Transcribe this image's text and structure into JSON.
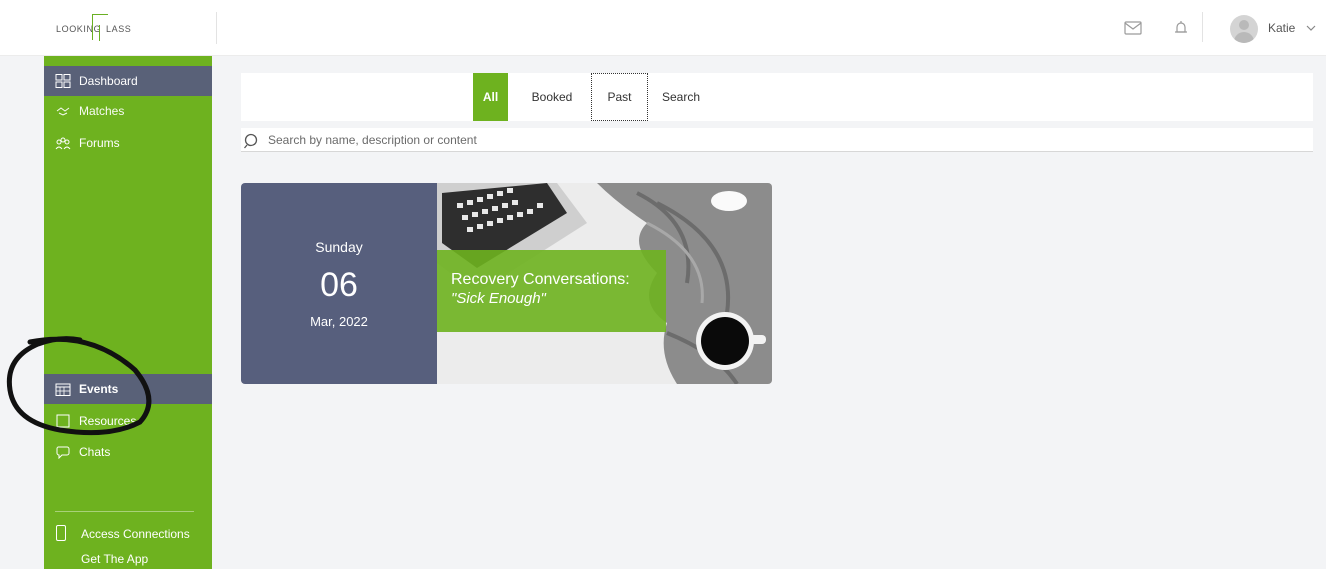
{
  "header": {
    "logo_text_left": "LOOKING",
    "logo_text_right": "LASS",
    "username": "Katie",
    "icons": [
      "mail-icon",
      "bell-icon",
      "avatar",
      "chevron-down-icon"
    ]
  },
  "sidebar": {
    "items": [
      {
        "label": "Dashboard",
        "icon": "grid-icon"
      },
      {
        "label": "Matches",
        "icon": "matches-icon"
      },
      {
        "label": "Forums",
        "icon": "forums-icon"
      },
      {
        "label": "Events",
        "icon": "calendar-icon"
      },
      {
        "label": "Resources",
        "icon": "resources-icon"
      },
      {
        "label": "Chats",
        "icon": "chats-icon"
      }
    ],
    "access_label": "Access Connections",
    "getapp_label": "Get The App"
  },
  "tabs": [
    {
      "label": "All"
    },
    {
      "label": "Booked"
    },
    {
      "label": "Past"
    },
    {
      "label": "Search"
    }
  ],
  "search": {
    "placeholder": "Search by name, description or content",
    "value": ""
  },
  "events": [
    {
      "day_name": "Sunday",
      "day_num": "06",
      "month_year": "Mar, 2022",
      "title": "Recovery Conversations:",
      "subtitle": "\"Sick Enough\""
    }
  ],
  "colors": {
    "brand_green": "#6eb21f",
    "nav_active": "#596178",
    "date_panel": "#575f7d"
  }
}
